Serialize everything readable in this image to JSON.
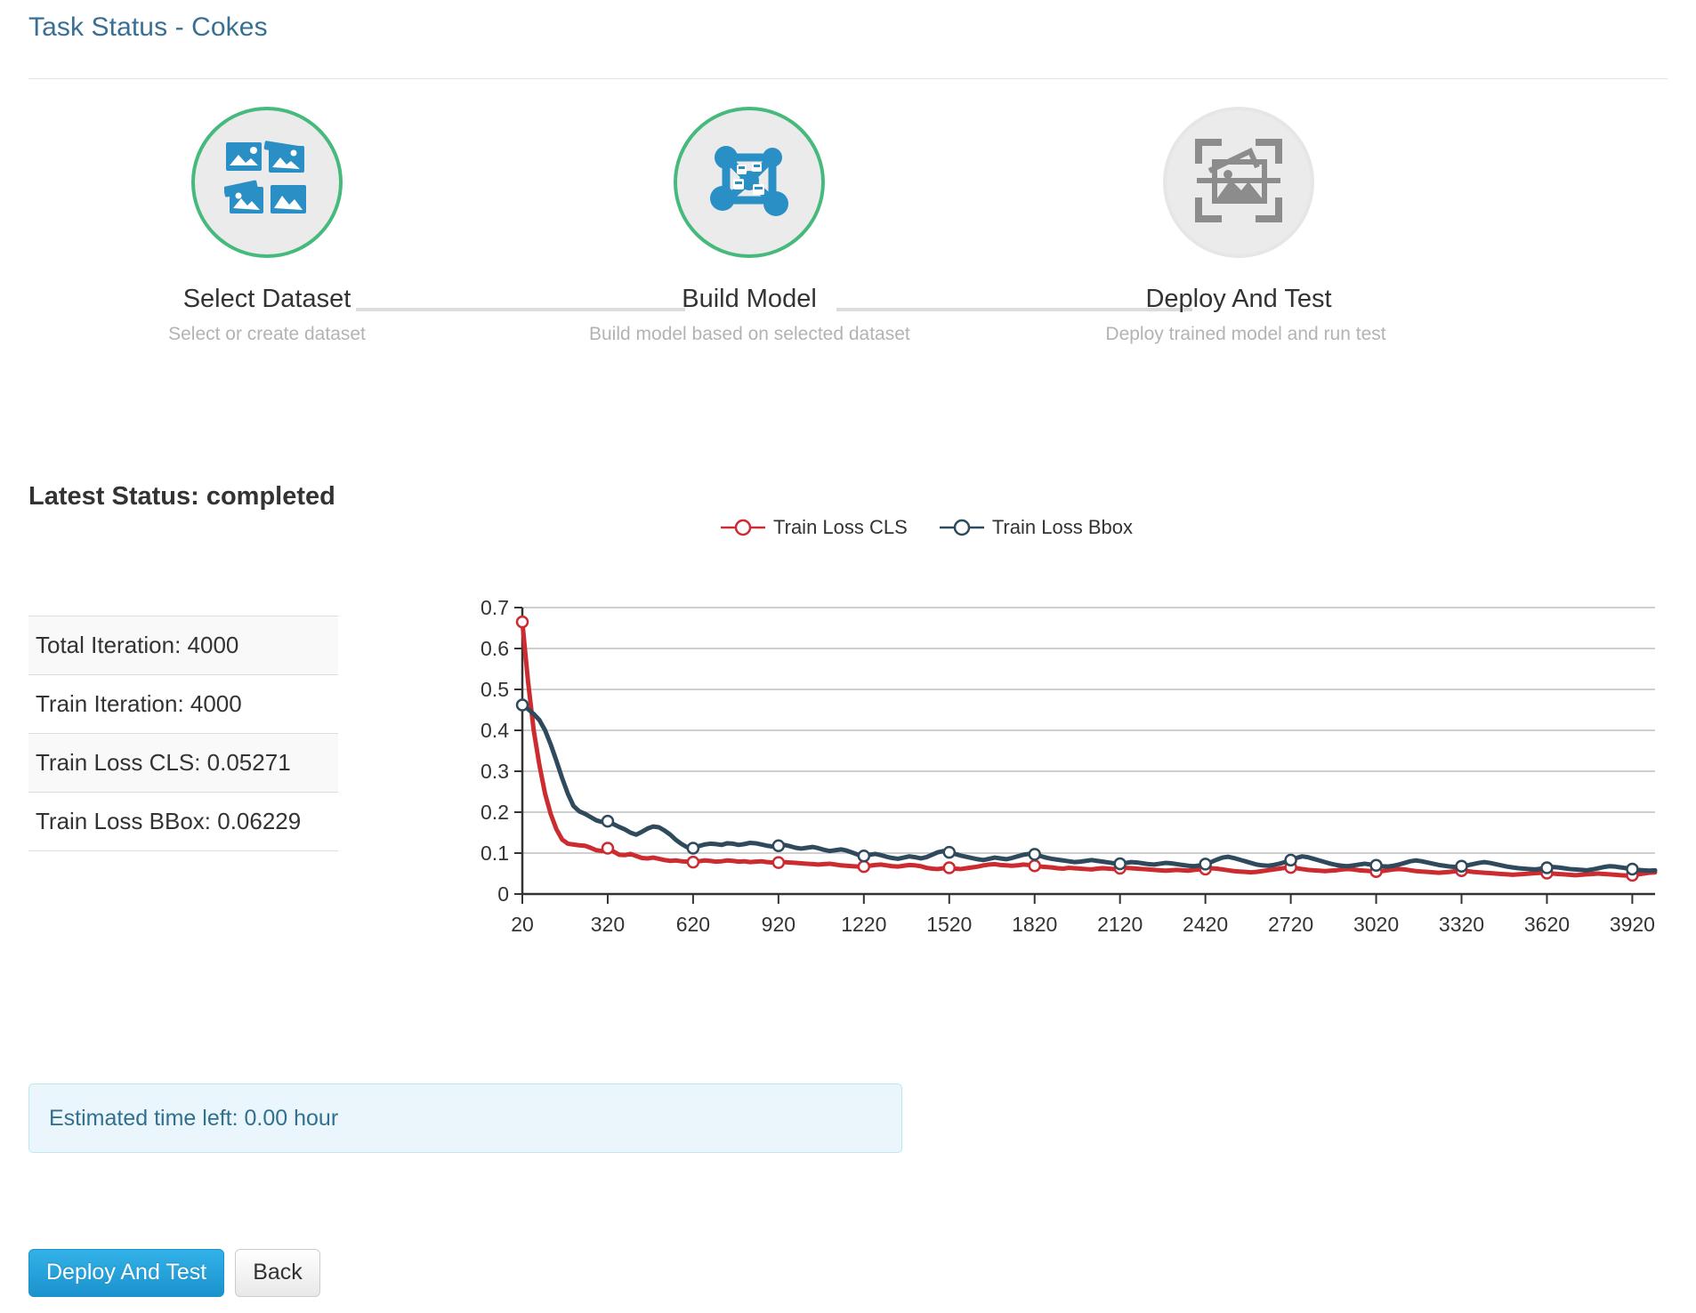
{
  "header": {
    "title": "Task Status - Cokes",
    "title_color": "#3a6f95"
  },
  "stepper": {
    "steps": [
      {
        "name": "Select Dataset",
        "description": "Select or create dataset",
        "icon": "image-grid-icon",
        "state": "active"
      },
      {
        "name": "Build Model",
        "description": "Build model based on selected dataset",
        "icon": "neural-network-icon",
        "state": "active"
      },
      {
        "name": "Deploy And Test",
        "description": "Deploy trained model and run test",
        "icon": "image-scan-icon",
        "state": "inactive"
      }
    ],
    "active_color": "#46b97c",
    "inactive_color": "#e6e6e6",
    "icon_active_color": "#2a8fc4",
    "icon_inactive_color": "#8c8c8c"
  },
  "status": {
    "heading": "Latest Status: completed"
  },
  "info_table": {
    "rows": [
      {
        "text": "Total Iteration: 4000"
      },
      {
        "text": "Train Iteration: 4000"
      },
      {
        "text": "Train Loss CLS: 0.05271"
      },
      {
        "text": "Train Loss BBox: 0.06229"
      }
    ]
  },
  "alert": {
    "text": "Estimated time left: 0.00 hour"
  },
  "buttons": {
    "primary": "Deploy And Test",
    "secondary": "Back"
  },
  "chart_data": {
    "type": "line",
    "title": "",
    "xlabel": "",
    "ylabel": "",
    "xlim": [
      20,
      4000
    ],
    "ylim": [
      0,
      0.7
    ],
    "ytick_labels": [
      "0",
      "0.1",
      "0.2",
      "0.3",
      "0.4",
      "0.5",
      "0.6",
      "0.7"
    ],
    "yticks": [
      0,
      0.1,
      0.2,
      0.3,
      0.4,
      0.5,
      0.6,
      0.7
    ],
    "xtick_labels": [
      "20",
      "320",
      "620",
      "920",
      "1220",
      "1520",
      "1820",
      "2120",
      "2420",
      "2720",
      "3020",
      "3320",
      "3620",
      "3920"
    ],
    "xticks": [
      20,
      320,
      620,
      920,
      1220,
      1520,
      1820,
      2120,
      2420,
      2720,
      3020,
      3320,
      3620,
      3920
    ],
    "grid": true,
    "legend_position": "top-center",
    "marker": "open-circle",
    "marker_interval": 300,
    "x": [
      20,
      40,
      60,
      80,
      100,
      120,
      140,
      160,
      180,
      200,
      220,
      240,
      260,
      280,
      300,
      320,
      340,
      360,
      380,
      400,
      420,
      440,
      460,
      480,
      500,
      520,
      540,
      560,
      580,
      600,
      620,
      640,
      660,
      680,
      700,
      720,
      740,
      760,
      780,
      800,
      820,
      840,
      860,
      880,
      900,
      920,
      940,
      960,
      980,
      1000,
      1020,
      1040,
      1060,
      1080,
      1100,
      1120,
      1140,
      1160,
      1180,
      1200,
      1220,
      1240,
      1260,
      1280,
      1300,
      1320,
      1340,
      1360,
      1380,
      1400,
      1420,
      1440,
      1460,
      1480,
      1500,
      1520,
      1540,
      1560,
      1580,
      1600,
      1620,
      1640,
      1660,
      1680,
      1700,
      1720,
      1740,
      1760,
      1780,
      1800,
      1820,
      1840,
      1860,
      1880,
      1900,
      1920,
      1940,
      1960,
      1980,
      2000,
      2020,
      2040,
      2060,
      2080,
      2100,
      2120,
      2140,
      2160,
      2180,
      2200,
      2220,
      2240,
      2260,
      2280,
      2300,
      2320,
      2340,
      2360,
      2380,
      2400,
      2420,
      2440,
      2460,
      2480,
      2500,
      2520,
      2540,
      2560,
      2580,
      2600,
      2620,
      2640,
      2660,
      2680,
      2700,
      2720,
      2740,
      2760,
      2780,
      2800,
      2820,
      2840,
      2860,
      2880,
      2900,
      2920,
      2940,
      2960,
      2980,
      3000,
      3020,
      3040,
      3060,
      3080,
      3100,
      3120,
      3140,
      3160,
      3180,
      3200,
      3220,
      3240,
      3260,
      3280,
      3300,
      3320,
      3340,
      3360,
      3380,
      3400,
      3420,
      3440,
      3460,
      3480,
      3500,
      3520,
      3540,
      3560,
      3580,
      3600,
      3620,
      3640,
      3660,
      3680,
      3700,
      3720,
      3740,
      3760,
      3780,
      3800,
      3820,
      3840,
      3860,
      3880,
      3900,
      3920,
      3940,
      3960,
      3980,
      4000
    ],
    "series": [
      {
        "name": "Train Loss CLS",
        "color": "#cc2b30",
        "values": [
          0.665,
          0.52,
          0.4,
          0.315,
          0.245,
          0.195,
          0.158,
          0.133,
          0.123,
          0.121,
          0.119,
          0.118,
          0.113,
          0.107,
          0.105,
          0.112,
          0.104,
          0.096,
          0.095,
          0.098,
          0.093,
          0.088,
          0.087,
          0.089,
          0.086,
          0.083,
          0.081,
          0.082,
          0.08,
          0.079,
          0.078,
          0.08,
          0.082,
          0.081,
          0.079,
          0.08,
          0.082,
          0.081,
          0.079,
          0.08,
          0.078,
          0.079,
          0.08,
          0.078,
          0.077,
          0.077,
          0.078,
          0.077,
          0.076,
          0.075,
          0.074,
          0.073,
          0.072,
          0.073,
          0.074,
          0.072,
          0.07,
          0.069,
          0.068,
          0.067,
          0.067,
          0.069,
          0.071,
          0.072,
          0.07,
          0.068,
          0.067,
          0.069,
          0.071,
          0.07,
          0.068,
          0.064,
          0.062,
          0.061,
          0.063,
          0.064,
          0.062,
          0.061,
          0.063,
          0.065,
          0.067,
          0.07,
          0.072,
          0.073,
          0.071,
          0.07,
          0.069,
          0.07,
          0.072,
          0.071,
          0.069,
          0.067,
          0.066,
          0.065,
          0.063,
          0.062,
          0.064,
          0.063,
          0.062,
          0.061,
          0.06,
          0.062,
          0.063,
          0.062,
          0.061,
          0.063,
          0.064,
          0.063,
          0.062,
          0.061,
          0.06,
          0.059,
          0.058,
          0.057,
          0.058,
          0.059,
          0.058,
          0.057,
          0.059,
          0.06,
          0.061,
          0.063,
          0.062,
          0.06,
          0.058,
          0.056,
          0.055,
          0.054,
          0.053,
          0.054,
          0.056,
          0.058,
          0.06,
          0.062,
          0.064,
          0.065,
          0.063,
          0.061,
          0.059,
          0.058,
          0.057,
          0.056,
          0.057,
          0.058,
          0.06,
          0.061,
          0.06,
          0.058,
          0.057,
          0.056,
          0.055,
          0.056,
          0.058,
          0.06,
          0.061,
          0.06,
          0.058,
          0.056,
          0.055,
          0.054,
          0.053,
          0.052,
          0.053,
          0.054,
          0.056,
          0.057,
          0.056,
          0.054,
          0.053,
          0.052,
          0.051,
          0.05,
          0.049,
          0.048,
          0.047,
          0.048,
          0.049,
          0.05,
          0.051,
          0.052,
          0.051,
          0.05,
          0.049,
          0.048,
          0.047,
          0.046,
          0.047,
          0.048,
          0.049,
          0.05,
          0.049,
          0.048,
          0.047,
          0.046,
          0.045,
          0.046,
          0.048,
          0.05,
          0.052,
          0.053
        ]
      },
      {
        "name": "Train Loss Bbox",
        "color": "#2e4a5c",
        "values": [
          0.462,
          0.452,
          0.44,
          0.425,
          0.4,
          0.365,
          0.325,
          0.283,
          0.245,
          0.215,
          0.202,
          0.196,
          0.188,
          0.18,
          0.176,
          0.178,
          0.171,
          0.164,
          0.158,
          0.15,
          0.145,
          0.152,
          0.16,
          0.165,
          0.163,
          0.155,
          0.145,
          0.132,
          0.122,
          0.114,
          0.112,
          0.117,
          0.121,
          0.123,
          0.122,
          0.12,
          0.124,
          0.123,
          0.12,
          0.122,
          0.125,
          0.124,
          0.121,
          0.118,
          0.116,
          0.118,
          0.12,
          0.117,
          0.113,
          0.111,
          0.113,
          0.115,
          0.112,
          0.108,
          0.105,
          0.107,
          0.109,
          0.106,
          0.101,
          0.096,
          0.093,
          0.096,
          0.098,
          0.095,
          0.091,
          0.088,
          0.086,
          0.089,
          0.092,
          0.09,
          0.087,
          0.09,
          0.096,
          0.102,
          0.105,
          0.102,
          0.098,
          0.094,
          0.091,
          0.088,
          0.085,
          0.083,
          0.086,
          0.089,
          0.087,
          0.085,
          0.088,
          0.092,
          0.096,
          0.098,
          0.097,
          0.093,
          0.089,
          0.086,
          0.084,
          0.082,
          0.08,
          0.078,
          0.079,
          0.081,
          0.083,
          0.081,
          0.079,
          0.077,
          0.075,
          0.074,
          0.076,
          0.078,
          0.077,
          0.075,
          0.073,
          0.072,
          0.074,
          0.076,
          0.075,
          0.073,
          0.071,
          0.069,
          0.068,
          0.07,
          0.073,
          0.078,
          0.084,
          0.089,
          0.091,
          0.088,
          0.084,
          0.08,
          0.076,
          0.072,
          0.07,
          0.069,
          0.071,
          0.074,
          0.078,
          0.083,
          0.088,
          0.092,
          0.09,
          0.086,
          0.082,
          0.078,
          0.074,
          0.071,
          0.069,
          0.068,
          0.07,
          0.072,
          0.074,
          0.072,
          0.07,
          0.068,
          0.067,
          0.069,
          0.072,
          0.076,
          0.08,
          0.082,
          0.08,
          0.077,
          0.074,
          0.071,
          0.069,
          0.067,
          0.066,
          0.068,
          0.07,
          0.073,
          0.076,
          0.078,
          0.076,
          0.073,
          0.07,
          0.067,
          0.065,
          0.063,
          0.062,
          0.061,
          0.06,
          0.062,
          0.064,
          0.066,
          0.065,
          0.063,
          0.061,
          0.06,
          0.059,
          0.058,
          0.06,
          0.063,
          0.066,
          0.068,
          0.067,
          0.065,
          0.063,
          0.061,
          0.059,
          0.058,
          0.057,
          0.058,
          0.06,
          0.062
        ]
      }
    ]
  }
}
